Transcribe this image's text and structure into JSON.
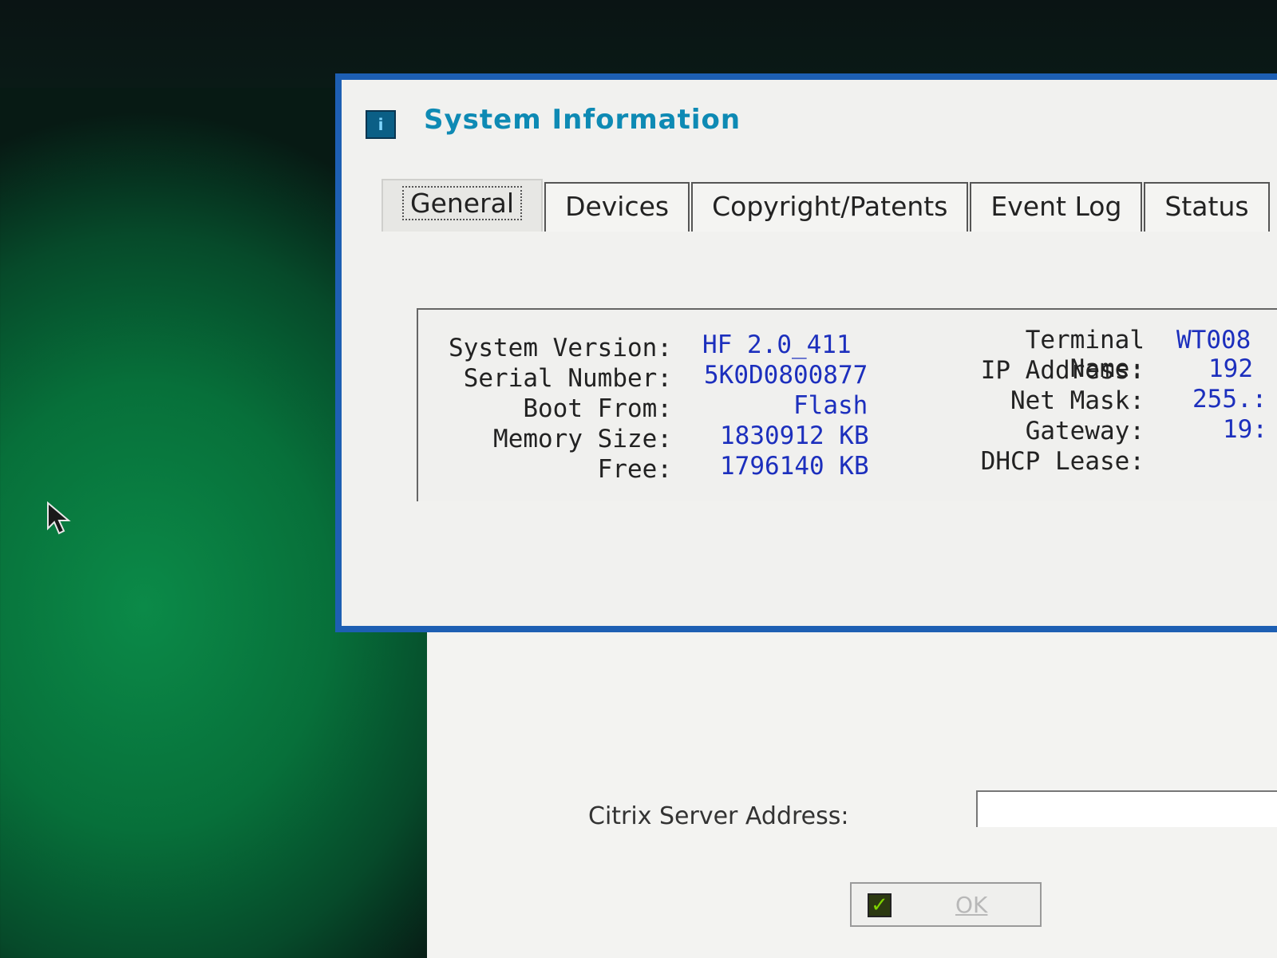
{
  "window": {
    "title": "System Information"
  },
  "tabs": [
    {
      "label": "General",
      "active": true
    },
    {
      "label": "Devices",
      "active": false
    },
    {
      "label": "Copyright/Patents",
      "active": false
    },
    {
      "label": "Event Log",
      "active": false
    },
    {
      "label": "Status",
      "active": false
    }
  ],
  "general": {
    "left": [
      {
        "label": "System Version:",
        "value": "HF  2.0_411"
      },
      {
        "label": "Serial Number:",
        "value": "5K0D0800877"
      },
      {
        "label": "Boot From:",
        "value": "Flash"
      },
      {
        "label": "Memory Size:",
        "value": "1830912 KB"
      },
      {
        "label": "Free:",
        "value": "1796140 KB"
      }
    ],
    "right": [
      {
        "label": "Terminal Name:",
        "value": "WT008"
      },
      {
        "label": "IP Address:",
        "value": "192"
      },
      {
        "label": "Net Mask:",
        "value": "255.:"
      },
      {
        "label": "Gateway:",
        "value": "19:"
      },
      {
        "label": "DHCP Lease:",
        "value": ""
      }
    ]
  },
  "citrix": {
    "server_address_label": "Citrix Server Address:",
    "server_address_value": "",
    "ok_label": "OK"
  },
  "colors": {
    "title": "#0e8ab4",
    "value_text": "#1c2fbd",
    "window_border": "#1d5fb3",
    "desktop": "#07703a"
  }
}
